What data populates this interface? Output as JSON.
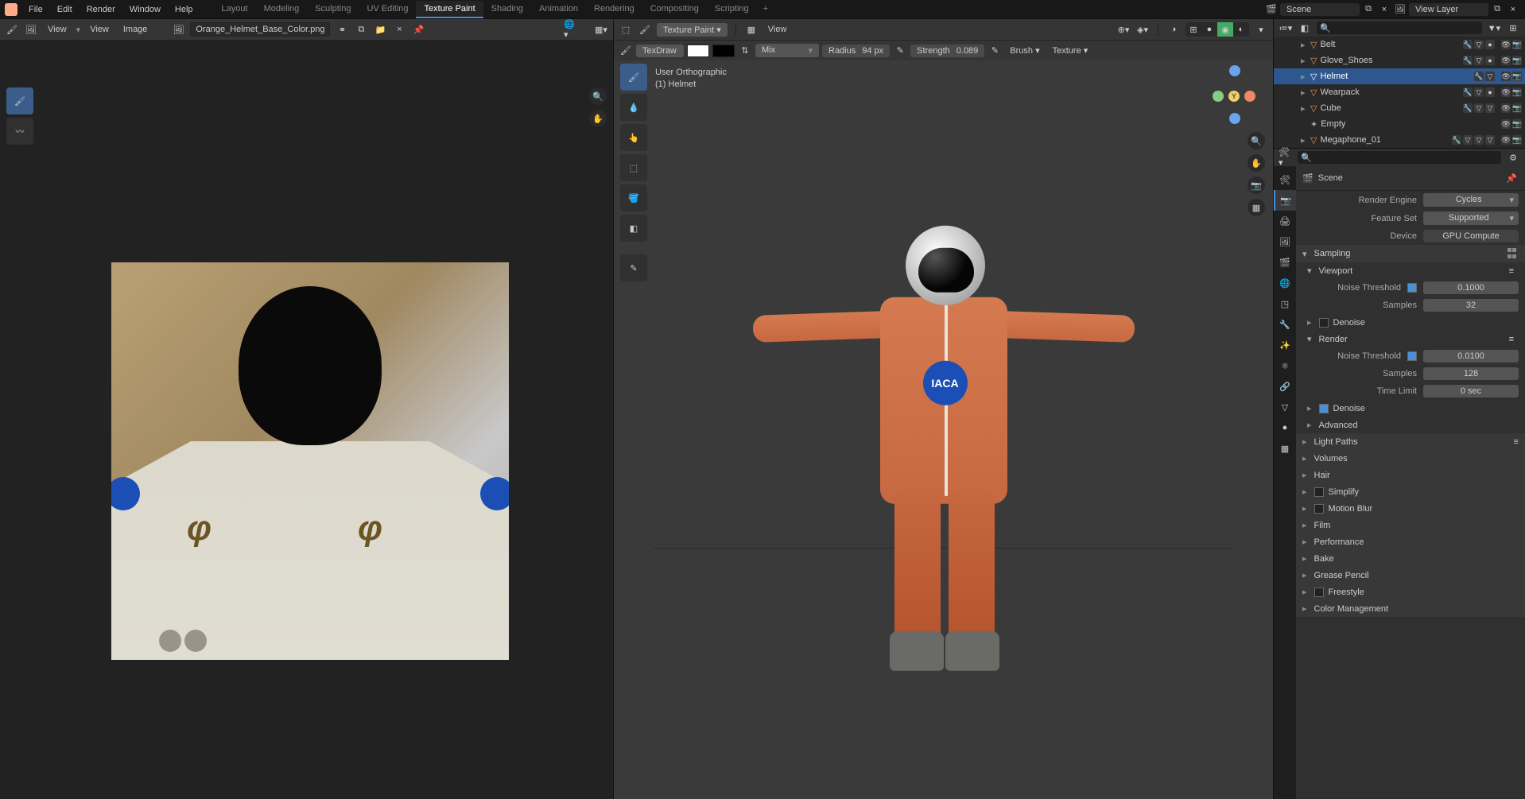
{
  "top_menu": [
    "File",
    "Edit",
    "Render",
    "Window",
    "Help"
  ],
  "workspaces": [
    "Layout",
    "Modeling",
    "Sculpting",
    "UV Editing",
    "Texture Paint",
    "Shading",
    "Animation",
    "Rendering",
    "Compositing",
    "Scripting"
  ],
  "workspace_active": "Texture Paint",
  "scene_name": "Scene",
  "view_layer": "View Layer",
  "image_editor": {
    "view_labels": [
      "View",
      "View",
      "Image"
    ],
    "image_name": "Orange_Helmet_Base_Color.png"
  },
  "viewport": {
    "mode": "Texture Paint",
    "view_label": "View",
    "brush_name": "TexDraw",
    "blend": "Mix",
    "radius_label": "Radius",
    "radius_value": "94 px",
    "strength_label": "Strength",
    "strength_value": "0.089",
    "brush_drop": "Brush",
    "texture_drop": "Texture",
    "overlay_line1": "User Orthographic",
    "overlay_line2": "(1) Helmet",
    "badge_text": "IACA"
  },
  "outliner": {
    "items": [
      {
        "name": "Belt",
        "sel": false
      },
      {
        "name": "Glove_Shoes",
        "sel": false
      },
      {
        "name": "Helmet",
        "sel": true
      },
      {
        "name": "Wearpack",
        "sel": false
      },
      {
        "name": "Cube",
        "sel": false
      },
      {
        "name": "Empty",
        "sel": false,
        "empty": true
      },
      {
        "name": "Megaphone_01",
        "sel": false
      }
    ]
  },
  "props": {
    "crumb": "Scene",
    "render_engine_lbl": "Render Engine",
    "render_engine": "Cycles",
    "feature_set_lbl": "Feature Set",
    "feature_set": "Supported",
    "device_lbl": "Device",
    "device": "GPU Compute",
    "sampling": "Sampling",
    "viewport_hdr": "Viewport",
    "noise_thr_lbl": "Noise Threshold",
    "vp_noise": "0.1000",
    "samples_lbl": "Samples",
    "vp_samples": "32",
    "denoise": "Denoise",
    "render_hdr": "Render",
    "r_noise": "0.0100",
    "r_samples": "128",
    "time_limit_lbl": "Time Limit",
    "time_limit": "0 sec",
    "advanced": "Advanced",
    "panels": [
      "Light Paths",
      "Volumes",
      "Hair",
      "Simplify",
      "Motion Blur",
      "Film",
      "Performance",
      "Bake",
      "Grease Pencil",
      "Freestyle",
      "Color Management"
    ]
  }
}
